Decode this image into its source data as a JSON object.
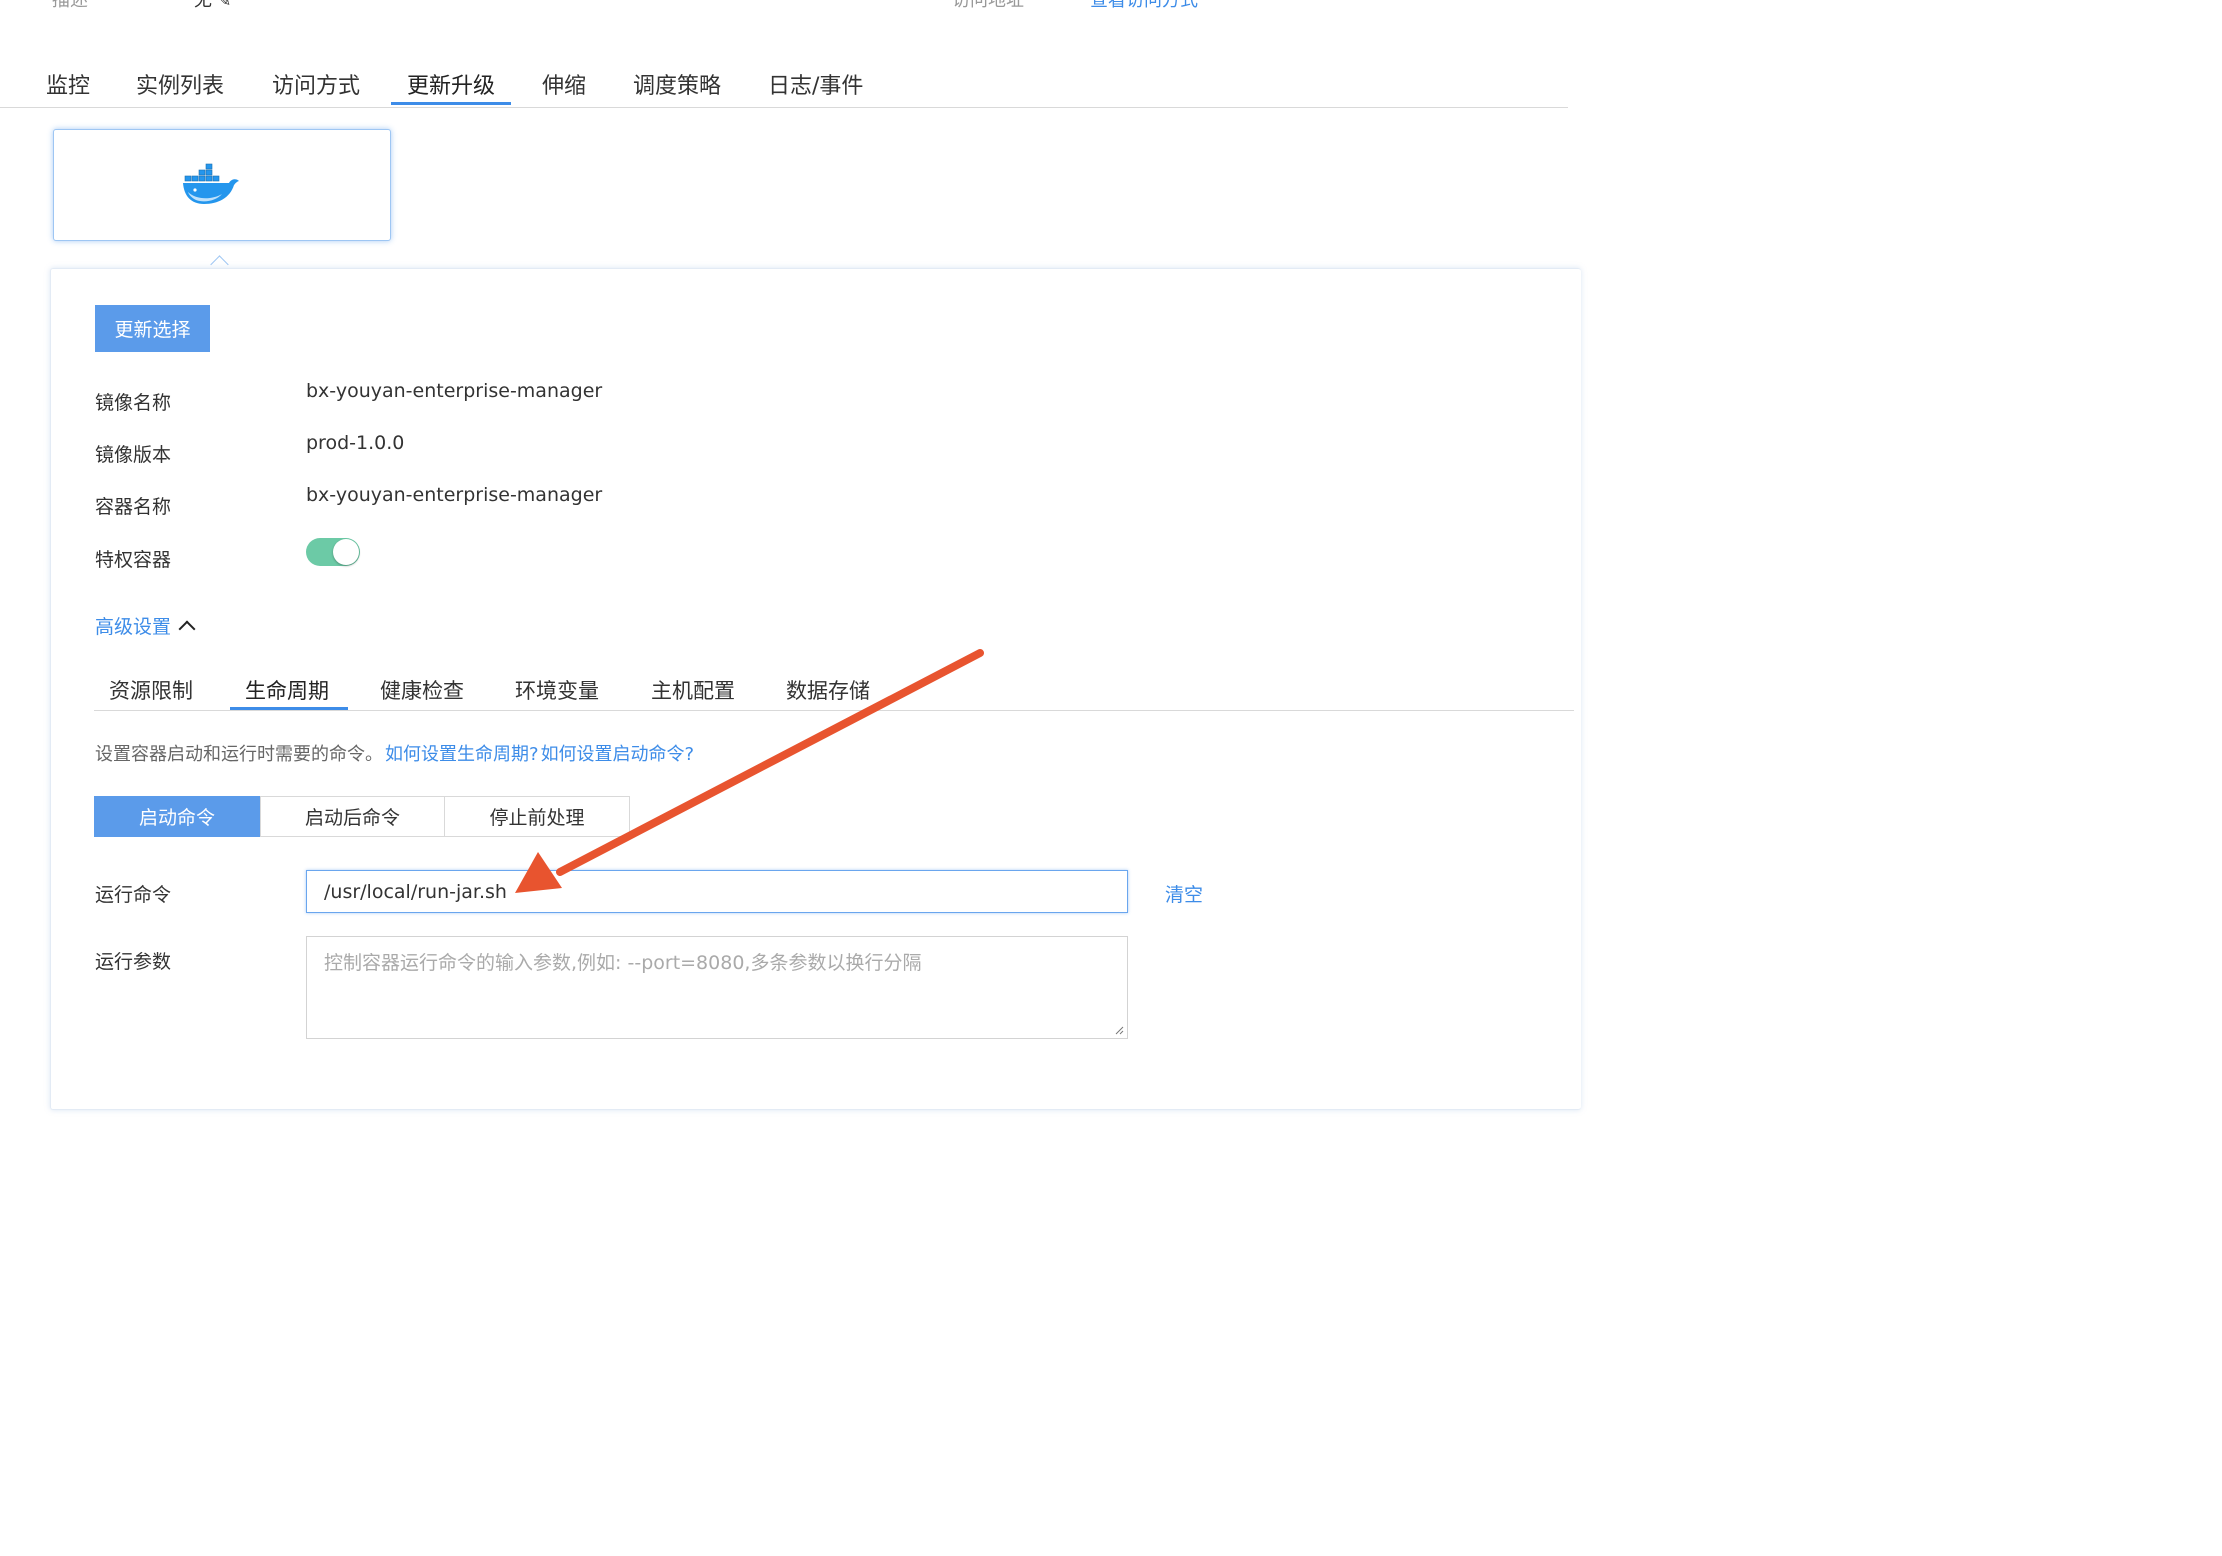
{
  "top": {
    "desc_label": "描述",
    "desc_value": "无",
    "access_label": "访问地址",
    "access_link": "查看访问方式"
  },
  "main_tabs": [
    "监控",
    "实例列表",
    "访问方式",
    "更新升级",
    "伸缩",
    "调度策略",
    "日志/事件"
  ],
  "main_tab_active": "更新升级",
  "image_card": {
    "icon": "docker-icon"
  },
  "update_button": "更新选择",
  "fields": {
    "image_name_label": "镜像名称",
    "image_name_value": "bx-youyan-enterprise-manager",
    "image_version_label": "镜像版本",
    "image_version_value": "prod-1.0.0",
    "container_name_label": "容器名称",
    "container_name_value": "bx-youyan-enterprise-manager",
    "privileged_label": "特权容器",
    "privileged_on": true
  },
  "advanced": {
    "label": "高级设置"
  },
  "sub_tabs": [
    "资源限制",
    "生命周期",
    "健康检查",
    "环境变量",
    "主机配置",
    "数据存储"
  ],
  "sub_tab_active": "生命周期",
  "hint": {
    "text": "设置容器启动和运行时需要的命令。",
    "link1": "如何设置生命周期?",
    "link2": "如何设置启动命令?"
  },
  "segments": [
    "启动命令",
    "启动后命令",
    "停止前处理"
  ],
  "segment_active": "启动命令",
  "run_command": {
    "label": "运行命令",
    "value": "/usr/local/run-jar.sh",
    "clear": "清空"
  },
  "run_args": {
    "label": "运行参数",
    "placeholder": "控制容器运行命令的输入参数,例如: --port=8080,多条参数以换行分隔"
  },
  "colors": {
    "accent": "#3d8ce8",
    "button": "#5b9bea",
    "toggle": "#6ccaa6",
    "annotation_arrow": "#e8542f"
  }
}
